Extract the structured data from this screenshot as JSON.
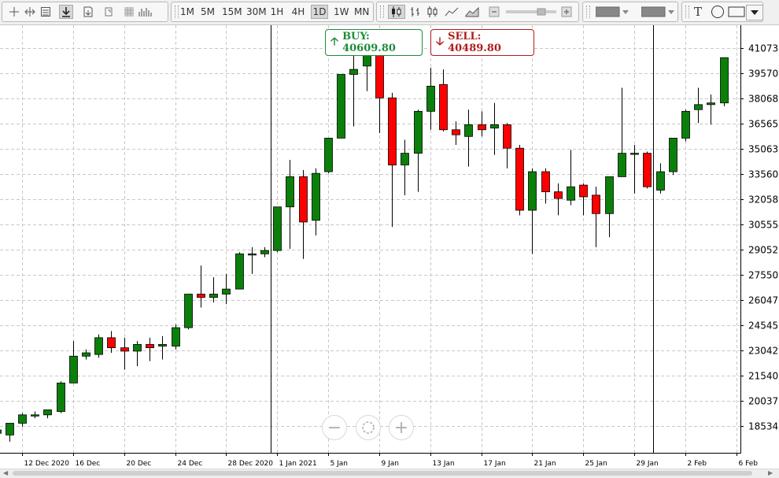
{
  "toolbar": {
    "timeframes": [
      "1M",
      "5M",
      "15M",
      "30M",
      "1H",
      "4H",
      "1D",
      "1W",
      "MN"
    ],
    "active_timeframe": "1D",
    "text_tool": "T"
  },
  "quotes": {
    "buy_label": "BUY: 40609.80",
    "sell_label": "SELL: 40489.80",
    "buy_color": "#1e8b3a",
    "sell_color": "#b01c1c"
  },
  "navigation": {
    "zoom_out": "−",
    "zoom_in": "+"
  },
  "chart_data": {
    "type": "candlestick",
    "bull_color": "#0a800a",
    "bear_color": "#ff0000",
    "y_ticks": [
      "41073.",
      "39570.",
      "38068.",
      "36565.",
      "35063.",
      "33560.",
      "32058.",
      "30555.",
      "29052.",
      "27550.",
      "26047.",
      "24545.",
      "23042.",
      "21540.",
      "20037.",
      "18534."
    ],
    "x_ticks": [
      "12 Dec 2020",
      "16 Dec",
      "20 Dec",
      "24 Dec",
      "28 Dec 2020",
      "1 Jan 2021",
      "5 Jan",
      "9 Jan",
      "13 Jan",
      "17 Jan",
      "21 Jan",
      "25 Jan",
      "29 Jan",
      "2 Feb",
      "6 Feb"
    ],
    "ylim": [
      17300,
      41600
    ],
    "grid": true,
    "candles": [
      {
        "date": "2020-12-10",
        "o": 18100,
        "h": 18600,
        "l": 17900,
        "c": 18300
      },
      {
        "date": "2020-12-11",
        "o": 18000,
        "h": 18700,
        "l": 17600,
        "c": 18700
      },
      {
        "date": "2020-12-12",
        "o": 18700,
        "h": 19300,
        "l": 18500,
        "c": 19200
      },
      {
        "date": "2020-12-13",
        "o": 19200,
        "h": 19400,
        "l": 19000,
        "c": 19200
      },
      {
        "date": "2020-12-14",
        "o": 19200,
        "h": 19500,
        "l": 19000,
        "c": 19500
      },
      {
        "date": "2020-12-15",
        "o": 19400,
        "h": 21200,
        "l": 19300,
        "c": 21100
      },
      {
        "date": "2020-12-16",
        "o": 21100,
        "h": 23600,
        "l": 21100,
        "c": 22700
      },
      {
        "date": "2020-12-17",
        "o": 22700,
        "h": 23100,
        "l": 22500,
        "c": 22900
      },
      {
        "date": "2020-12-18",
        "o": 22800,
        "h": 24000,
        "l": 22600,
        "c": 23800
      },
      {
        "date": "2020-12-19",
        "o": 23800,
        "h": 24200,
        "l": 22900,
        "c": 23200
      },
      {
        "date": "2020-12-20",
        "o": 23200,
        "h": 23800,
        "l": 21900,
        "c": 23000
      },
      {
        "date": "2020-12-21",
        "o": 23000,
        "h": 23600,
        "l": 22100,
        "c": 23400
      },
      {
        "date": "2020-12-22",
        "o": 23400,
        "h": 23800,
        "l": 22400,
        "c": 23200
      },
      {
        "date": "2020-12-23",
        "o": 23300,
        "h": 23900,
        "l": 22500,
        "c": 23400
      },
      {
        "date": "2020-12-24",
        "o": 23300,
        "h": 24600,
        "l": 23100,
        "c": 24400
      },
      {
        "date": "2020-12-25",
        "o": 24400,
        "h": 26400,
        "l": 24300,
        "c": 26400
      },
      {
        "date": "2020-12-26",
        "o": 26400,
        "h": 28100,
        "l": 25600,
        "c": 26200
      },
      {
        "date": "2020-12-27",
        "o": 26200,
        "h": 27400,
        "l": 25900,
        "c": 26400
      },
      {
        "date": "2020-12-28",
        "o": 26400,
        "h": 27600,
        "l": 25800,
        "c": 26700
      },
      {
        "date": "2020-12-29",
        "o": 26700,
        "h": 28900,
        "l": 26700,
        "c": 28800
      },
      {
        "date": "2020-12-30",
        "o": 28800,
        "h": 29200,
        "l": 27600,
        "c": 28800
      },
      {
        "date": "2020-12-31",
        "o": 28800,
        "h": 29200,
        "l": 28600,
        "c": 29000
      },
      {
        "date": "2021-01-01",
        "o": 29000,
        "h": 31400,
        "l": 28900,
        "c": 31600
      },
      {
        "date": "2021-01-02",
        "o": 31600,
        "h": 34400,
        "l": 29100,
        "c": 33400
      },
      {
        "date": "2021-01-03",
        "o": 33400,
        "h": 33800,
        "l": 28500,
        "c": 30700
      },
      {
        "date": "2021-01-04",
        "o": 30800,
        "h": 33900,
        "l": 29900,
        "c": 33600
      },
      {
        "date": "2021-01-05",
        "o": 33700,
        "h": 35400,
        "l": 33600,
        "c": 35700
      },
      {
        "date": "2021-01-06",
        "o": 35700,
        "h": 38600,
        "l": 35700,
        "c": 39500
      },
      {
        "date": "2021-01-07",
        "o": 39500,
        "h": 40700,
        "l": 36400,
        "c": 39800
      },
      {
        "date": "2021-01-08",
        "o": 40000,
        "h": 41300,
        "l": 38500,
        "c": 40900
      },
      {
        "date": "2021-01-09",
        "o": 40900,
        "h": 41200,
        "l": 36000,
        "c": 38100
      },
      {
        "date": "2021-01-10",
        "o": 38100,
        "h": 38400,
        "l": 30400,
        "c": 34100
      },
      {
        "date": "2021-01-11",
        "o": 34100,
        "h": 35600,
        "l": 32300,
        "c": 34800
      },
      {
        "date": "2021-01-12",
        "o": 34800,
        "h": 37400,
        "l": 32500,
        "c": 37300
      },
      {
        "date": "2021-01-13",
        "o": 37300,
        "h": 39900,
        "l": 36200,
        "c": 38800
      },
      {
        "date": "2021-01-14",
        "o": 38900,
        "h": 39800,
        "l": 36100,
        "c": 36200
      },
      {
        "date": "2021-01-15",
        "o": 36200,
        "h": 36700,
        "l": 35300,
        "c": 35900
      },
      {
        "date": "2021-01-16",
        "o": 35800,
        "h": 37400,
        "l": 34000,
        "c": 36500
      },
      {
        "date": "2021-01-17",
        "o": 36500,
        "h": 37300,
        "l": 35800,
        "c": 36200
      },
      {
        "date": "2021-01-18",
        "o": 36300,
        "h": 37800,
        "l": 34700,
        "c": 36500
      },
      {
        "date": "2021-01-19",
        "o": 36500,
        "h": 36600,
        "l": 33900,
        "c": 35100
      },
      {
        "date": "2021-01-20",
        "o": 35100,
        "h": 35300,
        "l": 31100,
        "c": 31400
      },
      {
        "date": "2021-01-21",
        "o": 31400,
        "h": 33900,
        "l": 28800,
        "c": 33700
      },
      {
        "date": "2021-01-22",
        "o": 33700,
        "h": 33900,
        "l": 31800,
        "c": 32500
      },
      {
        "date": "2021-01-23",
        "o": 32500,
        "h": 33000,
        "l": 31100,
        "c": 32100
      },
      {
        "date": "2021-01-24",
        "o": 32000,
        "h": 35000,
        "l": 31700,
        "c": 32800
      },
      {
        "date": "2021-01-25",
        "o": 32900,
        "h": 33000,
        "l": 31100,
        "c": 32200
      },
      {
        "date": "2021-01-26",
        "o": 32300,
        "h": 32800,
        "l": 29200,
        "c": 31200
      },
      {
        "date": "2021-01-27",
        "o": 31200,
        "h": 33400,
        "l": 29800,
        "c": 33400
      },
      {
        "date": "2021-01-28",
        "o": 33400,
        "h": 38700,
        "l": 33400,
        "c": 34800
      },
      {
        "date": "2021-01-29",
        "o": 34800,
        "h": 35300,
        "l": 32400,
        "c": 34800
      },
      {
        "date": "2021-01-30",
        "o": 34800,
        "h": 34900,
        "l": 32700,
        "c": 32800
      },
      {
        "date": "2021-01-31",
        "o": 32600,
        "h": 34200,
        "l": 32400,
        "c": 33700
      },
      {
        "date": "2021-02-01",
        "o": 33700,
        "h": 35600,
        "l": 33500,
        "c": 35700
      },
      {
        "date": "2021-02-02",
        "o": 35700,
        "h": 37400,
        "l": 35500,
        "c": 37300
      },
      {
        "date": "2021-02-03",
        "o": 37400,
        "h": 38700,
        "l": 36600,
        "c": 37700
      },
      {
        "date": "2021-02-04",
        "o": 37700,
        "h": 38300,
        "l": 36500,
        "c": 37800
      },
      {
        "date": "2021-02-05",
        "o": 37800,
        "h": 40200,
        "l": 37600,
        "c": 40500
      }
    ],
    "separators": [
      "2021-01-01",
      "2021-01-31"
    ]
  }
}
